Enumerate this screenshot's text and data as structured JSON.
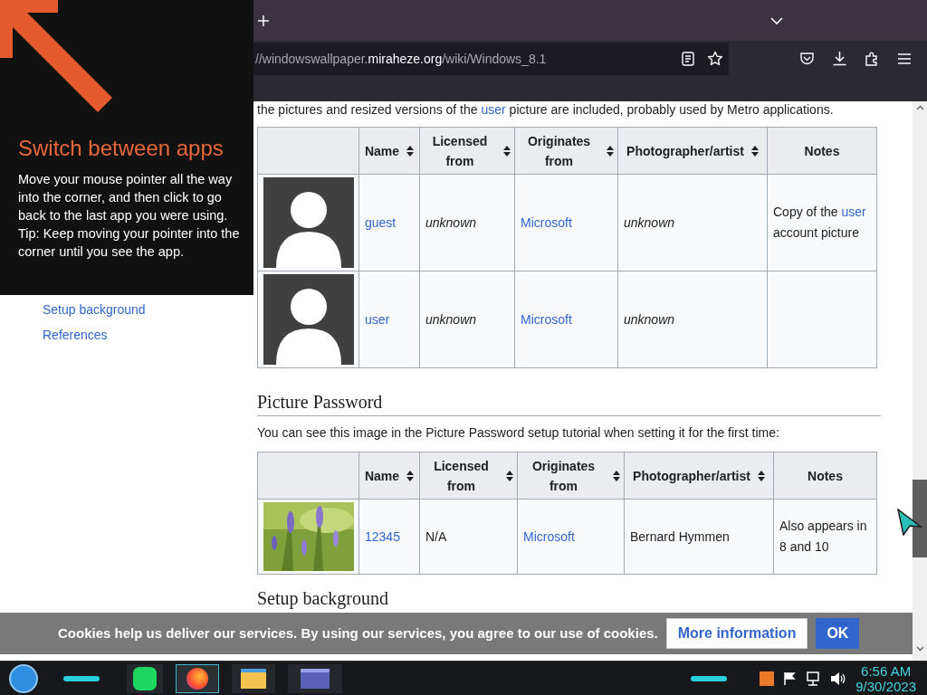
{
  "start_tip": {
    "title": "Switch between apps",
    "body": "Move your mouse pointer all the way into the corner, and then click to go back to the last app you were using.",
    "tip": "Tip: Keep moving your pointer into the corner until you see the app."
  },
  "sidebar": {
    "items": [
      {
        "label": "Setup background"
      },
      {
        "label": "References"
      }
    ]
  },
  "browser": {
    "url": {
      "prefix": "//windowswallpaper.",
      "domain": "miraheze.org",
      "path": "/wiki/Windows_8.1"
    }
  },
  "intro": {
    "before": "the pictures and resized versions of the ",
    "link": "user",
    "after": " picture are included, probably used by Metro applications."
  },
  "tables": [
    {
      "columns": [
        {
          "sortable": false
        },
        {
          "label": "Name",
          "sortable": true
        },
        {
          "label": "Licensed from",
          "sortable": true
        },
        {
          "label": "Originates from",
          "sortable": true
        },
        {
          "label": "Photographer/artist",
          "sortable": true
        },
        {
          "label": "Notes",
          "sortable": false
        }
      ],
      "rows": [
        {
          "cells": [
            {
              "kind": "avatar"
            },
            {
              "kind": "link",
              "text": "guest"
            },
            {
              "kind": "italic",
              "text": "unknown"
            },
            {
              "kind": "link",
              "text": "Microsoft"
            },
            {
              "kind": "italic",
              "text": "unknown"
            },
            {
              "kind": "mixed",
              "parts": [
                {
                  "text": "Copy of the ",
                  "link": false
                },
                {
                  "text": "user",
                  "link": true
                },
                {
                  "text": " account picture",
                  "link": false
                }
              ]
            }
          ]
        },
        {
          "cells": [
            {
              "kind": "avatar"
            },
            {
              "kind": "link",
              "text": "user"
            },
            {
              "kind": "italic",
              "text": "unknown"
            },
            {
              "kind": "link",
              "text": "Microsoft"
            },
            {
              "kind": "italic",
              "text": "unknown"
            },
            {
              "kind": "empty"
            }
          ]
        }
      ]
    },
    {
      "heading": "Picture Password",
      "text": "You can see this image in the Picture Password setup tutorial when setting it for the first time:",
      "columns": [
        {
          "sortable": false
        },
        {
          "label": "Name",
          "sortable": true
        },
        {
          "label": "Licensed from",
          "sortable": true
        },
        {
          "label": "Originates from",
          "sortable": true
        },
        {
          "label": "Photographer/artist",
          "sortable": true
        },
        {
          "label": "Notes",
          "sortable": false
        }
      ],
      "rows": [
        {
          "cells": [
            {
              "kind": "picture"
            },
            {
              "kind": "link",
              "text": "12345"
            },
            {
              "kind": "plain",
              "text": "N/A"
            },
            {
              "kind": "link",
              "text": "Microsoft"
            },
            {
              "kind": "plain",
              "text": "Bernard Hymmen"
            },
            {
              "kind": "plain",
              "text": "Also appears in 8 and 10"
            }
          ]
        }
      ]
    }
  ],
  "next_heading": "Setup background",
  "cookie": {
    "text": "Cookies help us deliver our services. By using our services, you agree to our use of cookies.",
    "buttons": [
      {
        "label": "More information",
        "kind": "secondary"
      },
      {
        "label": "OK",
        "kind": "primary"
      }
    ]
  },
  "taskbar": {
    "time": "6:56 AM",
    "date": "9/30/2023"
  }
}
